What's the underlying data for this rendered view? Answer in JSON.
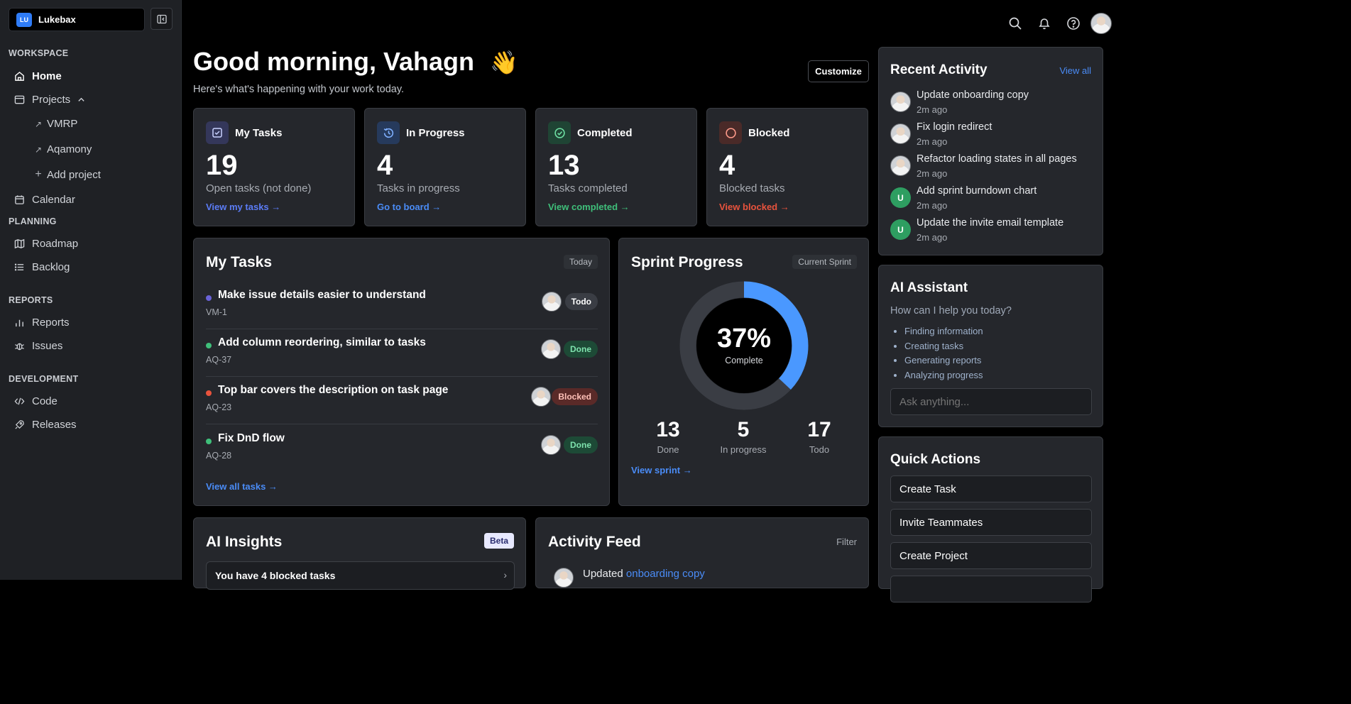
{
  "workspace": {
    "logo": "LU",
    "name": "Lukebax"
  },
  "sidebar": {
    "sections": {
      "workspace": "WORKSPACE",
      "planning": "PLANNING",
      "reports": "REPORTS",
      "development": "DEVELOPMENT"
    },
    "home": "Home",
    "projects": "Projects",
    "project_items": [
      "VMRP",
      "Aqamony"
    ],
    "add_project": "Add project",
    "calendar": "Calendar",
    "roadmap": "Roadmap",
    "backlog": "Backlog",
    "reports": "Reports",
    "issues": "Issues",
    "code": "Code",
    "releases": "Releases"
  },
  "header": {
    "greeting": "Good morning, Vahagn",
    "wave": "👋",
    "subtitle": "Here's what's happening with your work today.",
    "customize": "Customize"
  },
  "stats": [
    {
      "title": "My Tasks",
      "value": "19",
      "desc": "Open tasks (not done)",
      "link": "View my tasks →",
      "color": "#5b7cf6"
    },
    {
      "title": "In Progress",
      "value": "4",
      "desc": "Tasks in progress",
      "link": "Go to board →",
      "color": "#4a8cf7"
    },
    {
      "title": "Completed",
      "value": "13",
      "desc": "Tasks completed",
      "link": "View completed →",
      "color": "#3fbf7a"
    },
    {
      "title": "Blocked",
      "value": "4",
      "desc": "Blocked tasks",
      "link": "View blocked →",
      "color": "#e9533d"
    }
  ],
  "my_tasks": {
    "title": "My Tasks",
    "tag": "Today",
    "items": [
      {
        "title": "Make issue details easier to understand",
        "key": "VM-1",
        "status": "Todo",
        "dot": "#6a63d8"
      },
      {
        "title": "Add column reordering, similar to tasks",
        "key": "AQ-37",
        "status": "Done",
        "dot": "#3fbf7a"
      },
      {
        "title": "Top bar covers the description on task page",
        "key": "AQ-23",
        "status": "Blocked",
        "dot": "#e9533d"
      },
      {
        "title": "Fix DnD flow",
        "key": "AQ-28",
        "status": "Done",
        "dot": "#3fbf7a"
      }
    ],
    "view_all": "View all tasks →"
  },
  "sprint": {
    "title": "Sprint Progress",
    "tag": "Current Sprint",
    "percent": "37%",
    "percent_value": 0.37,
    "complete_label": "Complete",
    "done": "13",
    "done_label": "Done",
    "in_progress": "5",
    "in_progress_label": "In progress",
    "todo": "17",
    "todo_label": "Todo",
    "view": "View sprint →"
  },
  "recent_activity": {
    "title": "Recent Activity",
    "view_all": "View all",
    "items": [
      {
        "text": "Update onboarding copy",
        "time": "2m ago",
        "avatar": "photo"
      },
      {
        "text": "Fix login redirect",
        "time": "2m ago",
        "avatar": "photo"
      },
      {
        "text": "Refactor loading states in all pages",
        "time": "2m ago",
        "avatar": "photo"
      },
      {
        "text": "Add sprint burndown chart",
        "time": "2m ago",
        "avatar": "U"
      },
      {
        "text": "Update the invite email template",
        "time": "2m ago",
        "avatar": "U"
      }
    ]
  },
  "ai_assistant": {
    "title": "AI Assistant",
    "prompt": "How can I help you today?",
    "suggestions": [
      "Finding information",
      "Creating tasks",
      "Generating reports",
      "Analyzing progress"
    ],
    "placeholder": "Ask anything..."
  },
  "quick_actions": {
    "title": "Quick Actions",
    "buttons": [
      "Create Task",
      "Invite Teammates",
      "Create Project"
    ]
  },
  "ai_insights": {
    "title": "AI Insights",
    "badge": "Beta",
    "first_item": "You have 4 blocked tasks"
  },
  "activity_feed": {
    "title": "Activity Feed",
    "filter": "Filter",
    "first_prefix": "Updated",
    "first_link": "onboarding copy"
  }
}
